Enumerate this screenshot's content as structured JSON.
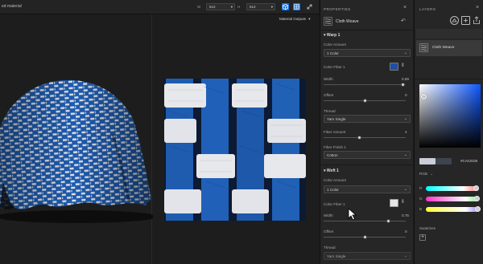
{
  "topbar": {
    "doc_title": "ed material",
    "size_label": "W",
    "size_w": "512",
    "size_sep": "H",
    "size_h": "512"
  },
  "viewport": {
    "output_label": "Material Outputs"
  },
  "properties": {
    "header": "PROPERTIES",
    "material_name": "Cloth Weave",
    "warp": {
      "title": "Warp 1",
      "color_amount_label": "Color Amount",
      "color_amount_value": "1 Color",
      "color_fiber_label": "Color Fiber 1",
      "color_fiber_swatch": "#1e4fa3",
      "width_label": "Width",
      "width_value": "0.89",
      "offset_label": "Offset",
      "offset_value": "0",
      "thread_label": "Thread",
      "thread_value": "Yarn Single",
      "fiber_amount_label": "Fiber Amount",
      "fiber_amount_value": "4",
      "fiber_finish_label": "Fiber Finish 1",
      "fiber_finish_value": "Cotton"
    },
    "weft": {
      "title": "Weft 1",
      "color_amount_label": "Color Amount",
      "color_amount_value": "1 Color",
      "color_fiber_label": "Color Fiber 1",
      "color_fiber_swatch": "#e6e6e6",
      "width_label": "Width",
      "width_value": "0.75",
      "offset_label": "Offset",
      "offset_value": "0",
      "thread_label": "Thread",
      "thread_value": "Yarn Single"
    }
  },
  "layers": {
    "header": "LAYERS",
    "layer_name": "Cloth Weave",
    "hex_value": "#CACED6",
    "rgb_label": "RGB",
    "r_label": "R",
    "g_label": "G",
    "b_label": "B",
    "swatches_label": "Swatches",
    "add_label": "+"
  },
  "colors": {
    "accent": "#1473e6",
    "weave_blue": "#1f5cb0",
    "weave_white": "#e4e6ea"
  }
}
